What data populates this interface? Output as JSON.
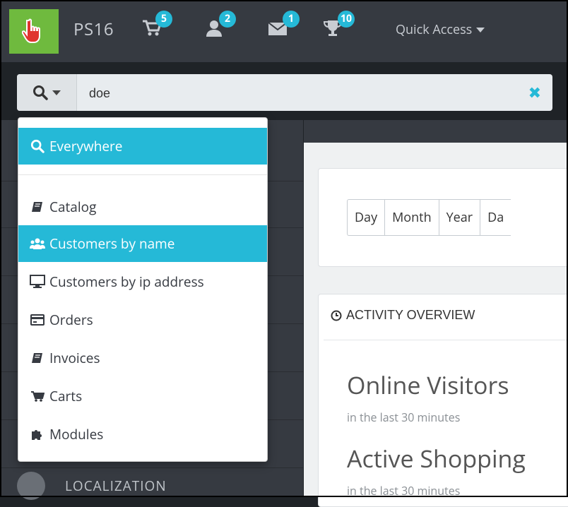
{
  "header": {
    "shop_name": "PS16",
    "quick_access_label": "Quick Access",
    "notifications": [
      {
        "icon": "cart-icon",
        "count": "5"
      },
      {
        "icon": "user-icon",
        "count": "2"
      },
      {
        "icon": "envelope-icon",
        "count": "1"
      },
      {
        "icon": "trophy-icon",
        "count": "10"
      }
    ]
  },
  "search": {
    "value": "doe",
    "clear_icon": "close-icon",
    "scope_options": [
      {
        "label": "Everywhere",
        "icon": "search-icon",
        "active": true
      },
      {
        "label": "Catalog",
        "icon": "book-icon",
        "active": false
      },
      {
        "label": "Customers by name",
        "icon": "users-icon",
        "active": true
      },
      {
        "label": "Customers by ip address",
        "icon": "desktop-icon",
        "active": false
      },
      {
        "label": "Orders",
        "icon": "credit-card-icon",
        "active": false
      },
      {
        "label": "Invoices",
        "icon": "book-icon",
        "active": false
      },
      {
        "label": "Carts",
        "icon": "cart-icon",
        "active": false
      },
      {
        "label": "Modules",
        "icon": "puzzle-icon",
        "active": false
      }
    ]
  },
  "sidebar": {
    "localization_label": "LOCALIZATION"
  },
  "dashboard": {
    "period_buttons": [
      "Day",
      "Month",
      "Year",
      "Da"
    ],
    "activity_title": "ACTIVITY OVERVIEW",
    "online_visitors_title": "Online Visitors",
    "online_visitors_sub": "in the last 30 minutes",
    "active_shopping_title": "Active Shopping",
    "active_shopping_sub": "in the last 30 minutes"
  },
  "colors": {
    "accent": "#25b9d7",
    "logo_green": "#6fba3e",
    "topbar": "#363a41"
  }
}
